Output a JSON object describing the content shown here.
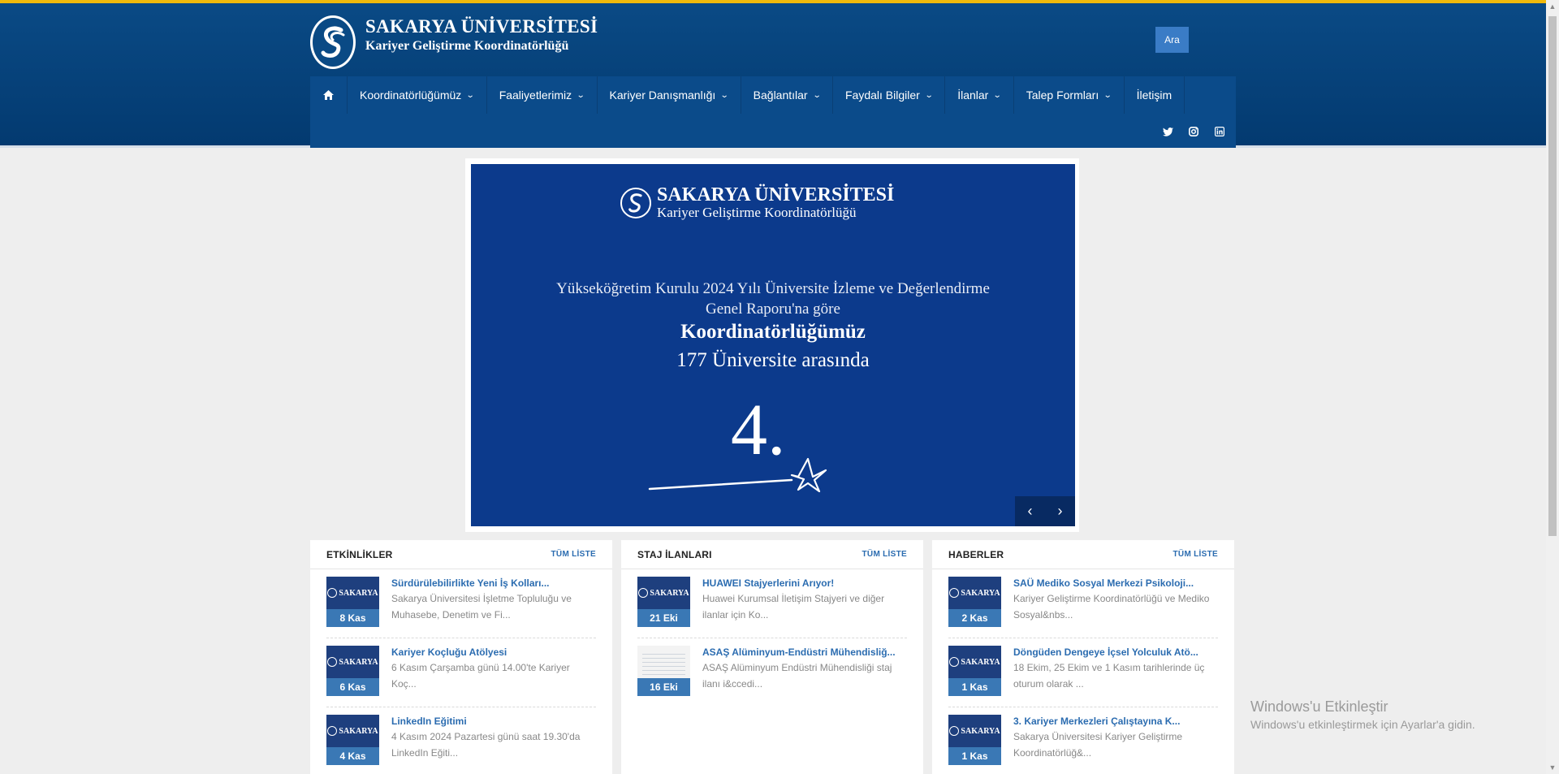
{
  "header": {
    "logo_title": "SAKARYA ÜNİVERSİTESİ",
    "logo_sub": "Kariyer Geliştirme Koordinatörlüğü",
    "search_label": "Ara"
  },
  "nav": {
    "items": [
      {
        "label": "Koordinatörlüğümüz",
        "dropdown": true
      },
      {
        "label": "Faaliyetlerimiz",
        "dropdown": true
      },
      {
        "label": "Kariyer Danışmanlığı",
        "dropdown": true
      },
      {
        "label": "Bağlantılar",
        "dropdown": true
      },
      {
        "label": "Faydalı Bilgiler",
        "dropdown": true
      },
      {
        "label": "İlanlar",
        "dropdown": true
      },
      {
        "label": "Talep Formları",
        "dropdown": true
      },
      {
        "label": "İletişim",
        "dropdown": false
      }
    ],
    "social": [
      "twitter-icon",
      "instagram-icon",
      "linkedin-icon"
    ]
  },
  "slider": {
    "logo_title": "SAKARYA ÜNİVERSİTESİ",
    "logo_sub": "Kariyer Geliştirme Koordinatörlüğü",
    "line1": "Yükseköğretim Kurulu 2024 Yılı Üniversite İzleme ve Değerlendirme",
    "line2": "Genel Raporu'na göre",
    "line3": "Koordinatörlüğümüz",
    "line4": "177 Üniversite arasında",
    "big": "4."
  },
  "panels": [
    {
      "title": "ETKİNLİKLER",
      "all_label": "TÜM LİSTE",
      "items": [
        {
          "date": "8 Kas",
          "title": "Sürdürülebilirlikte Yeni İş Kolları...",
          "text": "Sakarya Üniversitesi İşletme Topluluğu ve Muhasebe, Denetim ve Fi...",
          "thumb": "logo"
        },
        {
          "date": "6 Kas",
          "title": "Kariyer Koçluğu Atölyesi",
          "text": "6 Kasım Çarşamba günü 14.00'te Kariyer Koç...",
          "thumb": "logo"
        },
        {
          "date": "4 Kas",
          "title": "LinkedIn Eğitimi",
          "text": "4 Kasım 2024 Pazartesi günü saat 19.30'da LinkedIn Eğiti...",
          "thumb": "logo"
        }
      ]
    },
    {
      "title": "STAJ İLANLARI",
      "all_label": "TÜM LİSTE",
      "items": [
        {
          "date": "21 Eki",
          "title": "HUAWEI Stajyerlerini Arıyor!",
          "text": "Huawei Kurumsal İletişim Stajyeri ve diğer ilanlar için Ko...",
          "thumb": "logo"
        },
        {
          "date": "16 Eki",
          "title": "ASAŞ Alüminyum-Endüstri Mühendisliğ...",
          "text": "ASAŞ Alüminyum Endüstri Mühendisliği staj ilanı i&ccedi...",
          "thumb": "doc"
        }
      ]
    },
    {
      "title": "HABERLER",
      "all_label": "TÜM LİSTE",
      "items": [
        {
          "date": "2 Kas",
          "title": "SAÜ Mediko Sosyal Merkezi Psikoloji...",
          "text": "Kariyer Geliştirme Koordinatörlüğü ve Mediko Sosyal&nbs...",
          "thumb": "logo"
        },
        {
          "date": "1 Kas",
          "title": "Döngüden Dengeye İçsel Yolculuk Atö...",
          "text": "18 Ekim, 25 Ekim ve 1 Kasım tarihlerinde üç oturum olarak ...",
          "thumb": "logo"
        },
        {
          "date": "1 Kas",
          "title": "3. Kariyer Merkezleri Çalıştayına K...",
          "text": "Sakarya Üniversitesi Kariyer Geliştirme Koordinatörlüğ&...",
          "thumb": "logo"
        }
      ]
    }
  ],
  "thumb_logo_text": "SAKARYA",
  "watermark": {
    "line1": "Windows'u Etkinleştir",
    "line2": "Windows'u etkinleştirmek için Ayarlar'a gidin."
  }
}
